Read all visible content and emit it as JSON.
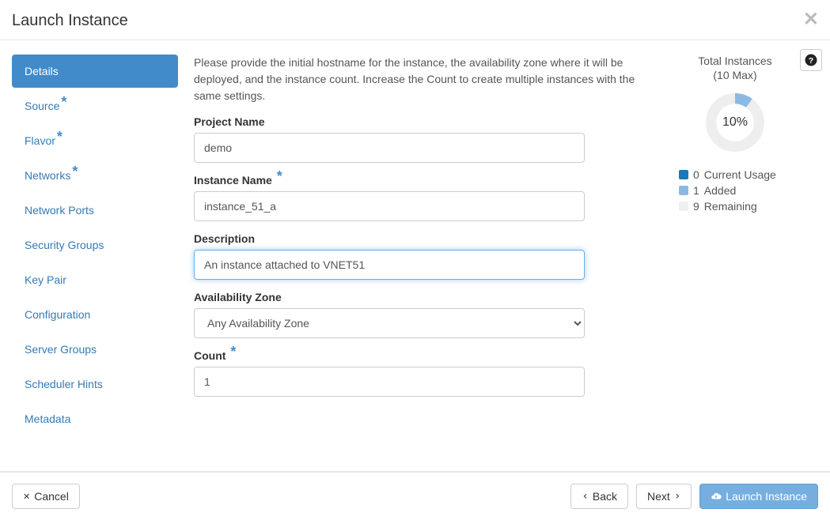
{
  "header": {
    "title": "Launch Instance"
  },
  "sidebar": {
    "items": [
      {
        "label": "Details",
        "active": true,
        "required": false
      },
      {
        "label": "Source",
        "active": false,
        "required": true
      },
      {
        "label": "Flavor",
        "active": false,
        "required": true
      },
      {
        "label": "Networks",
        "active": false,
        "required": true
      },
      {
        "label": "Network Ports",
        "active": false,
        "required": false
      },
      {
        "label": "Security Groups",
        "active": false,
        "required": false
      },
      {
        "label": "Key Pair",
        "active": false,
        "required": false
      },
      {
        "label": "Configuration",
        "active": false,
        "required": false
      },
      {
        "label": "Server Groups",
        "active": false,
        "required": false
      },
      {
        "label": "Scheduler Hints",
        "active": false,
        "required": false
      },
      {
        "label": "Metadata",
        "active": false,
        "required": false
      }
    ]
  },
  "main": {
    "intro": "Please provide the initial hostname for the instance, the availability zone where it will be deployed, and the instance count. Increase the Count to create multiple instances with the same settings.",
    "fields": {
      "project_name": {
        "label": "Project Name",
        "value": "demo",
        "required": false
      },
      "instance_name": {
        "label": "Instance Name",
        "value": "instance_51_a",
        "required": true
      },
      "description": {
        "label": "Description",
        "value": "An instance attached to VNET51",
        "required": false,
        "focused": true
      },
      "availability_zone": {
        "label": "Availability Zone",
        "value": "Any Availability Zone",
        "required": false
      },
      "count": {
        "label": "Count",
        "value": "1",
        "required": true
      }
    }
  },
  "quota": {
    "title": "Total Instances",
    "subtitle": "(10 Max)",
    "percent_label": "10%",
    "percent_value": 10,
    "legend": {
      "current": {
        "count": "0",
        "label": "Current Usage",
        "color": "#1f77b4"
      },
      "added": {
        "count": "1",
        "label": "Added",
        "color": "#8abae3"
      },
      "remain": {
        "count": "9",
        "label": "Remaining",
        "color": "#f0f0f0"
      }
    }
  },
  "footer": {
    "cancel": "Cancel",
    "back": "Back",
    "next": "Next",
    "launch": "Launch Instance"
  },
  "icons": {
    "close_glyph": "✕",
    "back_chev": "‹",
    "next_chev": "›"
  }
}
